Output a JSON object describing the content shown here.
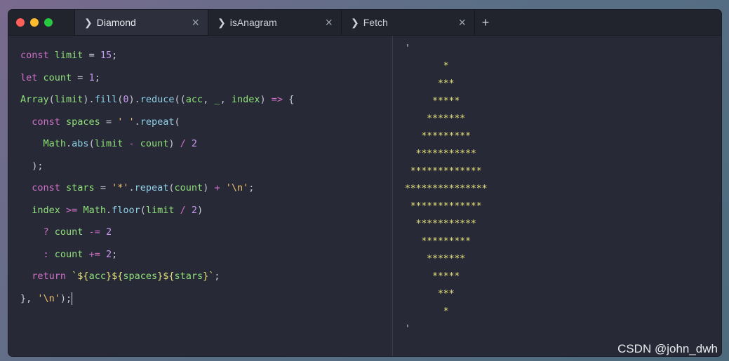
{
  "window": {
    "lights": [
      "#ff5f56",
      "#ffbd2e",
      "#27c93f"
    ]
  },
  "tabs": [
    {
      "label": "Diamond",
      "active": true
    },
    {
      "label": "isAnagram",
      "active": false
    },
    {
      "label": "Fetch",
      "active": false
    }
  ],
  "tab_glyphs": {
    "chevron": "❯",
    "close": "×",
    "new_tab": "+"
  },
  "code": {
    "lines": [
      [
        [
          "kw",
          "const "
        ],
        [
          "var",
          "limit "
        ],
        [
          "op",
          "= "
        ],
        [
          "num",
          "15"
        ],
        [
          "op",
          ";"
        ]
      ],
      [
        [
          "kw",
          "let "
        ],
        [
          "var",
          "count "
        ],
        [
          "op",
          "= "
        ],
        [
          "num",
          "1"
        ],
        [
          "op",
          ";"
        ]
      ],
      [
        [
          "var",
          "Array"
        ],
        [
          "op",
          "("
        ],
        [
          "var",
          "limit"
        ],
        [
          "op",
          ")."
        ],
        [
          "fn",
          "fill"
        ],
        [
          "op",
          "("
        ],
        [
          "num",
          "0"
        ],
        [
          "op",
          ")."
        ],
        [
          "fn",
          "reduce"
        ],
        [
          "op",
          "(("
        ],
        [
          "var",
          "acc"
        ],
        [
          "op",
          ", "
        ],
        [
          "var",
          "_"
        ],
        [
          "op",
          ", "
        ],
        [
          "var",
          "index"
        ],
        [
          "op",
          ") "
        ],
        [
          "kw",
          "=>"
        ],
        [
          "op",
          " {"
        ]
      ],
      [
        [
          "op",
          "  "
        ],
        [
          "kw",
          "const "
        ],
        [
          "var",
          "spaces "
        ],
        [
          "op",
          "= "
        ],
        [
          "str",
          "' '"
        ],
        [
          "op",
          "."
        ],
        [
          "fn",
          "repeat"
        ],
        [
          "op",
          "("
        ]
      ],
      [
        [
          "op",
          "    "
        ],
        [
          "var",
          "Math"
        ],
        [
          "op",
          "."
        ],
        [
          "fn",
          "abs"
        ],
        [
          "op",
          "("
        ],
        [
          "var",
          "limit "
        ],
        [
          "kw",
          "- "
        ],
        [
          "var",
          "count"
        ],
        [
          "op",
          ") "
        ],
        [
          "kw",
          "/ "
        ],
        [
          "num",
          "2"
        ]
      ],
      [
        [
          "op",
          "  );"
        ]
      ],
      [
        [
          "op",
          "  "
        ],
        [
          "kw",
          "const "
        ],
        [
          "var",
          "stars "
        ],
        [
          "op",
          "= "
        ],
        [
          "str",
          "'*'"
        ],
        [
          "op",
          "."
        ],
        [
          "fn",
          "repeat"
        ],
        [
          "op",
          "("
        ],
        [
          "var",
          "count"
        ],
        [
          "op",
          ") "
        ],
        [
          "kw",
          "+ "
        ],
        [
          "str",
          "'\\n'"
        ],
        [
          "op",
          ";"
        ]
      ],
      [
        [
          "op",
          "  "
        ],
        [
          "var",
          "index "
        ],
        [
          "kw",
          ">= "
        ],
        [
          "var",
          "Math"
        ],
        [
          "op",
          "."
        ],
        [
          "fn",
          "floor"
        ],
        [
          "op",
          "("
        ],
        [
          "var",
          "limit "
        ],
        [
          "kw",
          "/ "
        ],
        [
          "num",
          "2"
        ],
        [
          "op",
          ")"
        ]
      ],
      [
        [
          "op",
          "    "
        ],
        [
          "kw",
          "? "
        ],
        [
          "var",
          "count "
        ],
        [
          "kw",
          "-= "
        ],
        [
          "num",
          "2"
        ]
      ],
      [
        [
          "op",
          "    "
        ],
        [
          "kw",
          ": "
        ],
        [
          "var",
          "count "
        ],
        [
          "kw",
          "+= "
        ],
        [
          "num",
          "2"
        ],
        [
          "op",
          ";"
        ]
      ],
      [
        [
          "op",
          "  "
        ],
        [
          "kw",
          "return "
        ],
        [
          "tmpl",
          "`${"
        ],
        [
          "var",
          "acc"
        ],
        [
          "tmpl",
          "}${"
        ],
        [
          "var",
          "spaces"
        ],
        [
          "tmpl",
          "}${"
        ],
        [
          "var",
          "stars"
        ],
        [
          "tmpl",
          "}`"
        ],
        [
          "op",
          ";"
        ]
      ],
      [
        [
          "op",
          "}, "
        ],
        [
          "str",
          "'\\n'"
        ],
        [
          "op",
          ");"
        ]
      ]
    ]
  },
  "output": {
    "lines": [
      "'",
      "       *",
      "      ***",
      "     *****",
      "    *******",
      "   *********",
      "  ***********",
      " *************",
      "***************",
      " *************",
      "  ***********",
      "   *********",
      "    *******",
      "     *****",
      "      ***",
      "       *",
      "'"
    ]
  },
  "watermark": "CSDN @john_dwh"
}
